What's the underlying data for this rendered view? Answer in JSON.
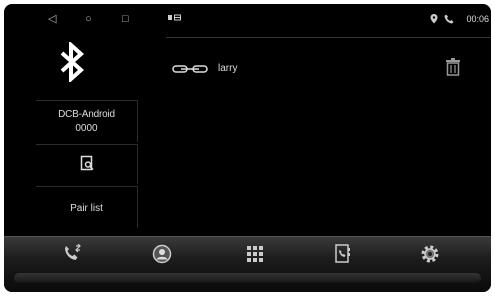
{
  "bluetooth": {
    "device_name": "DCB-Android",
    "pin": "0000",
    "pair_list_label": "Pair list"
  },
  "paired_devices": [
    {
      "name": "larry"
    }
  ],
  "status": {
    "time": "00:06"
  },
  "icons": {
    "system_nav": [
      "back-icon",
      "home-icon",
      "recents-icon"
    ],
    "status_left": [
      "notification-icon",
      "storage-icon"
    ],
    "status_right": [
      "location-icon",
      "phone-icon"
    ],
    "dock": [
      "phone-transfer-icon",
      "contacts-icon",
      "dialpad-icon",
      "phone-book-icon",
      "settings-icon"
    ]
  },
  "colors": {
    "background": "#000000",
    "text": "#dddddd"
  }
}
